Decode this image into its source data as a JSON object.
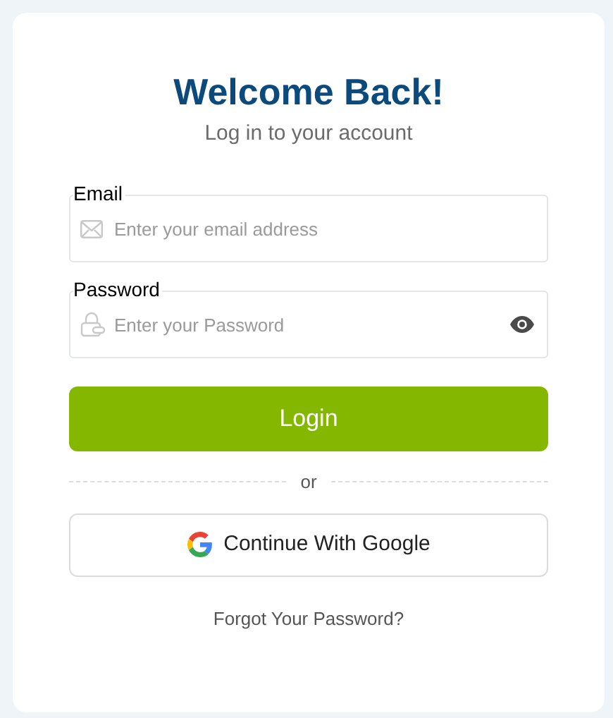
{
  "header": {
    "title": "Welcome Back!",
    "subtitle": "Log in to your account"
  },
  "fields": [
    {
      "kind": "email",
      "label": "Email",
      "placeholder": "Enter your email address"
    },
    {
      "kind": "password",
      "label": "Password",
      "placeholder": "Enter your Password"
    }
  ],
  "login_button": "Login",
  "divider": "or",
  "google_button": "Continue With Google",
  "forgot_link": "Forgot Your Password?"
}
